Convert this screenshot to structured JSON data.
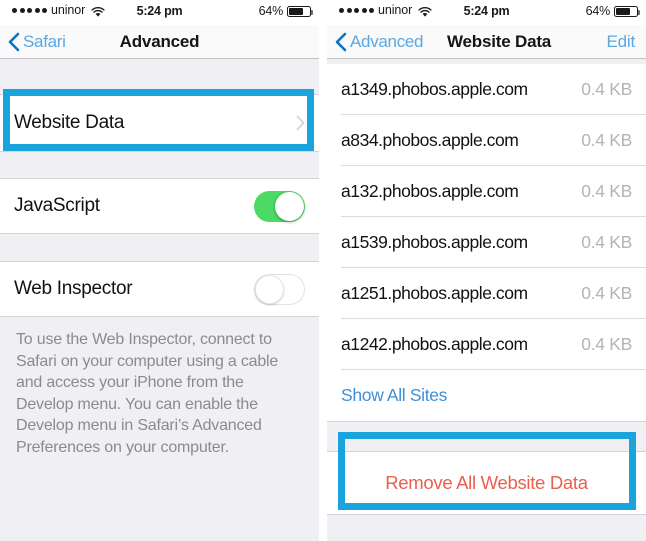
{
  "status_bar": {
    "carrier": "uninor",
    "signal_dots": 5,
    "wifi_icon": "wifi-icon",
    "time": "5:24 pm",
    "battery_percent": "64%",
    "battery_level": 64
  },
  "colors": {
    "highlight_box": "#1ba3dd",
    "toggle_on": "#4cd964",
    "tint_blue": "#5ba7e0",
    "link_blue": "#3f8fd8",
    "destructive_red": "#e8604f",
    "group_background": "#efeff4"
  },
  "left_panel": {
    "nav": {
      "back_label": "Safari",
      "back_icon": "chevron-left-icon",
      "title": "Advanced"
    },
    "rows": [
      {
        "label": "Website Data",
        "accessory": "chevron-right-icon",
        "highlighted": true
      }
    ],
    "toggles": [
      {
        "label": "JavaScript",
        "state": "on"
      },
      {
        "label": "Web Inspector",
        "state": "off"
      }
    ],
    "footer_note": "To use the Web Inspector, connect to Safari on your computer using a cable and access your iPhone from the Develop menu. You can enable the Develop menu in Safari’s Advanced Preferences on your computer."
  },
  "right_panel": {
    "nav": {
      "back_label": "Advanced",
      "back_icon": "chevron-left-icon",
      "title": "Website Data",
      "edit_label": "Edit"
    },
    "sites": [
      {
        "name": "a1349.phobos.apple.com",
        "size": "0.4 KB"
      },
      {
        "name": "a834.phobos.apple.com",
        "size": "0.4 KB"
      },
      {
        "name": "a132.phobos.apple.com",
        "size": "0.4 KB"
      },
      {
        "name": "a1539.phobos.apple.com",
        "size": "0.4 KB"
      },
      {
        "name": "a1251.phobos.apple.com",
        "size": "0.4 KB"
      },
      {
        "name": "a1242.phobos.apple.com",
        "size": "0.4 KB"
      }
    ],
    "show_all_label": "Show All Sites",
    "remove_all_label": "Remove All Website Data"
  }
}
